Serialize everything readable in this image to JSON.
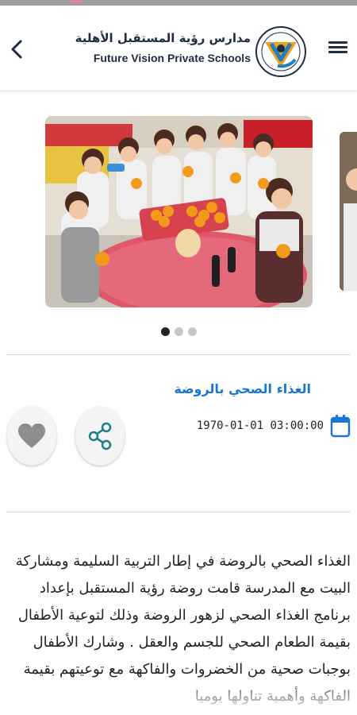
{
  "header": {
    "school_name_ar": "مدارس رؤية المستقبل الأهلية",
    "school_name_en": "Future Vision Private Schools",
    "back_icon": "chevron-left-icon",
    "menu_icon": "hamburger-menu-icon",
    "logo_icon": "school-logo-icon"
  },
  "carousel": {
    "active_index": 0,
    "slide_count": 3
  },
  "article": {
    "title": "الغذاء الصحي بالروضة",
    "datetime": "1970-01-01 03:00:00",
    "body": "الغذاء الصحي بالروضة   في إطار التربية السليمة ومشاركة البيت مع المدرسة قامت روضة رؤية المستقبل بإعداد برنامج الغذاء الصحي لزهور الروضة وذلك لتوعية الأطفال بقيمة الطعام الصحي للجسم والعقل . وشارك الأطفال بوجبات صحية من الخضروات والفاكهة مع توعيتهم بقيمة الفاكهة وأهمية تناولها يوميا"
  },
  "actions": {
    "like_icon": "heart-icon",
    "share_icon": "share-icon",
    "calendar_icon": "calendar-icon"
  },
  "colors": {
    "brand_navy": "#1f2a44",
    "title_blue": "#1976d2",
    "share_teal": "#1a7f8a",
    "logo_orange": "#f0a020",
    "heart_gray": "#8c8c8c"
  }
}
